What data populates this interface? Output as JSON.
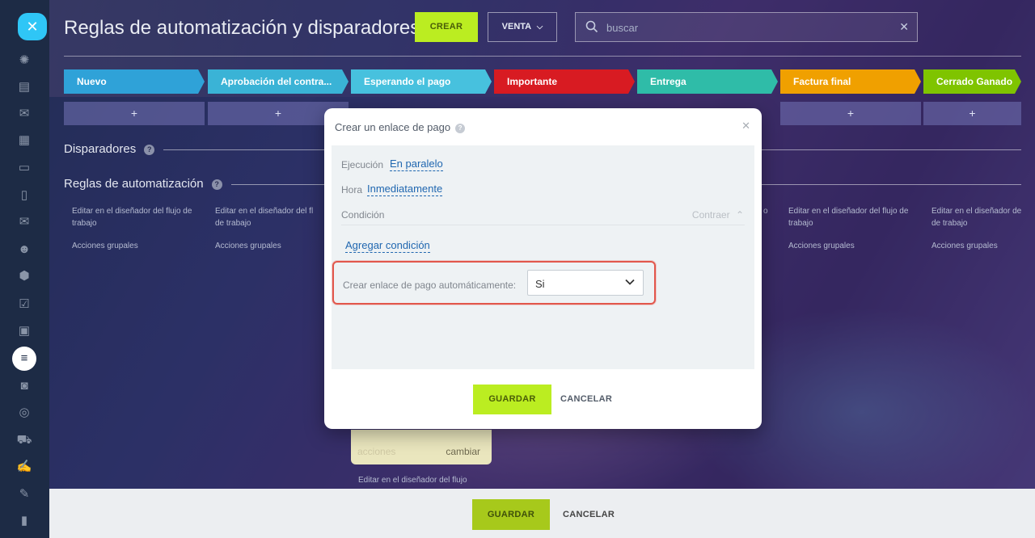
{
  "header": {
    "title": "Reglas de automatización y disparadores",
    "create_label": "CREAR",
    "pipeline_label": "VENTA",
    "search_placeholder": "buscar"
  },
  "stages": [
    {
      "label": "Nuevo",
      "color": "#2fa2d8"
    },
    {
      "label": "Aprobación del contra...",
      "color": "#3ab3d6"
    },
    {
      "label": "Esperando el pago",
      "color": "#47c1de"
    },
    {
      "label": "Importante",
      "color": "#d81b22"
    },
    {
      "label": "Entrega",
      "color": "#2fbca8"
    },
    {
      "label": "Factura final",
      "color": "#f0a000"
    },
    {
      "label": "Cerrado Ganado",
      "color": "#7fc400"
    }
  ],
  "plus_label": "+",
  "sections": {
    "triggers": "Disparadores",
    "rules": "Reglas de automatización"
  },
  "column_links": {
    "edit": "Editar en el diseñador del flujo de trabajo",
    "edit_truncated": "Editar en el diseñador de de trabajo",
    "edit_cut": "Editar en el diseñador del fl de trabajo",
    "group_actions": "Acciones grupales"
  },
  "card": {
    "left": "acciones",
    "right": "cambiar"
  },
  "under_card_text": "Editar en el diseñador del flujo",
  "bottom_bar": {
    "save": "GUARDAR",
    "cancel": "CANCELAR"
  },
  "modal": {
    "title": "Crear un enlace de pago",
    "execution_label": "Ejecución",
    "execution_value": "En paralelo",
    "time_label": "Hora",
    "time_value": "Inmediatamente",
    "condition_label": "Condición",
    "collapse_label": "Contraer",
    "add_condition": "Agregar condición",
    "auto_label": "Crear enlace de pago automáticamente:",
    "auto_value": "Si",
    "save": "GUARDAR",
    "cancel": "CANCELAR"
  }
}
